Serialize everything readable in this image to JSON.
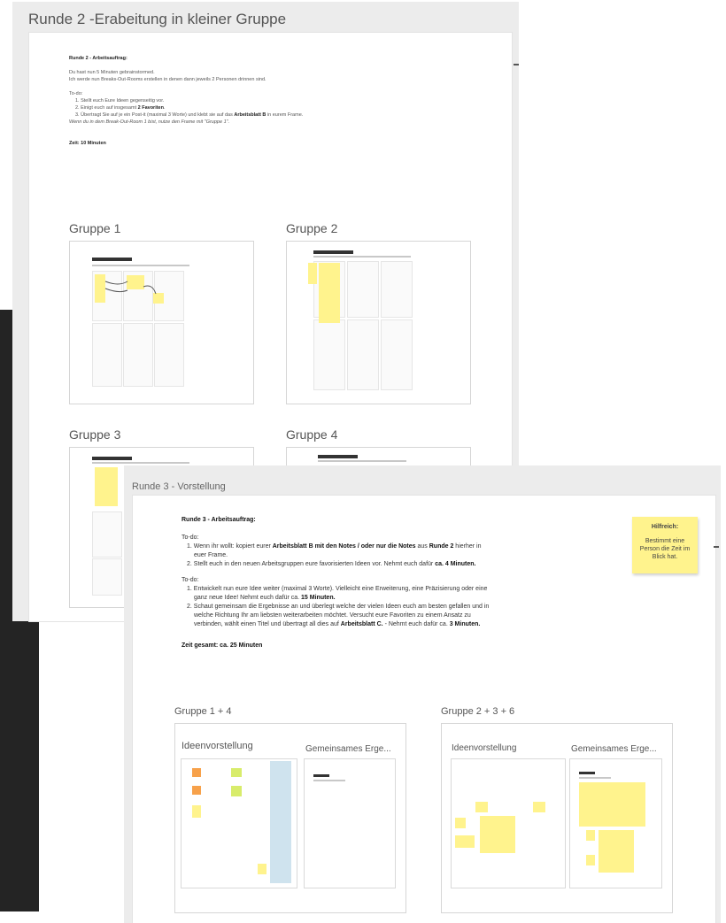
{
  "upper": {
    "frame_title": "Runde 2 -Erabeitung in kleiner Gruppe",
    "heading": "Runde 2 - Arbeitsauftrag:",
    "intro1": "Du hast nun 5 Minuten gebrainstormed.",
    "intro2": "Ich werde nun Breaks-Out-Rooms erstellen in denen dann jeweils 2 Personen drinnen sind.",
    "todo_label": "To-do:",
    "todo1": "1. Stellt euch Eure Ideen gegenseitig vor.",
    "todo2_pre": "2. Einigt euch auf insgesamt ",
    "todo2_bold": "2 Favoriten",
    "todo2_post": ".",
    "todo3_pre": "3. Übertragt Sie auf je ein Post-it (maximal 3 Worte) und klebt sie auf das ",
    "todo3_bold": "Arbeitsblatt B",
    "todo3_post": " in eurem Frame.",
    "note": "Wenn du in dem Break-Out-Room 1 bist, nutze den Frame mit \"Gruppe 1\".",
    "time": "Zeit: 10 Minuten",
    "groups": [
      "Gruppe 1",
      "Gruppe 2",
      "Gruppe 3",
      "Gruppe 4"
    ]
  },
  "lower": {
    "frame_title": "Runde 3 - Vorstellung",
    "heading": "Runde 3 - Arbeitsauftrag:",
    "todo_label_1": "To-do:",
    "a1_pre": "1. Wenn ihr wollt: kopiert eurer ",
    "a1_bold": "Arbeitsblatt B mit den Notes / oder nur die Notes",
    "a1_mid": " aus ",
    "a1_bold2": "Runde 2",
    "a1_post": " hierher in",
    "a1_cont": "euer Frame.",
    "a2_pre": "2. Stellt euch in den neuen Arbeitsgruppen eure favorisierten Ideen vor. Nehmt euch dafür ",
    "a2_bold": "ca. 4 Minuten.",
    "todo_label_2": "To-do:",
    "b1_line1": "1. Entwickelt nun eure Idee weiter (maximal 3 Worte). Vielleicht eine Erweiterung, eine Präzisierung oder eine",
    "b1_pre": "ganz neue Idee! Nehmt euch dafür ca. ",
    "b1_bold": "15 Minuten.",
    "b2_line1": "2. Schaut gemeinsam die Ergebnisse an und überlegt welche der vielen Ideen euch am besten gefallen und in",
    "b2_line2": "welche Richtung Ihr am liebsten weiterarbeiten möchtet. Versucht eure Favoriten zu einem Ansatz zu",
    "b2_pre": "verbinden, wählt einen Titel und übertragt all dies auf ",
    "b2_bold": "Arbeitsblatt C.",
    "b2_mid": " - Nehmt euch dafür ca. ",
    "b2_bold2": "3 Minuten.",
    "time": "Zeit gesamt: ca. 25 Minuten",
    "hilfreich_title": "Hilfreich:",
    "hilfreich_text": "Bestimmt eine Person die Zeit im Blick hat.",
    "group_a": "Gruppe 1 + 4",
    "group_b": "Gruppe 2 + 3 + 6",
    "sub_ideen": "Ideenvorstellung",
    "sub_ergebnis": "Gemeinsames Erge..."
  }
}
